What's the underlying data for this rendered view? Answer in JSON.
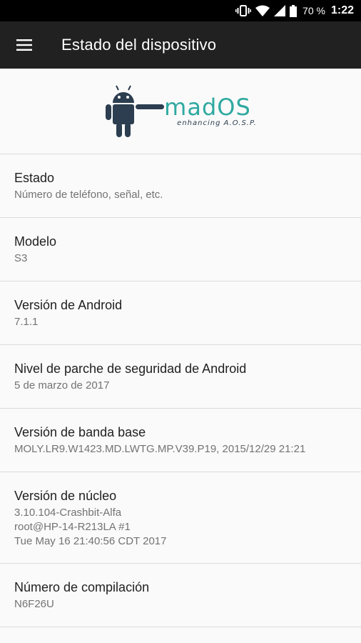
{
  "status_bar": {
    "icons": [
      "vibrate-icon",
      "wifi-icon",
      "cell-signal-icon",
      "battery-icon"
    ],
    "battery_percent": "70 %",
    "time": "1:22"
  },
  "app_bar": {
    "title": "Estado del dispositivo",
    "menu_icon": "hamburger-menu-icon"
  },
  "logo": {
    "word": "madOS",
    "tagline": "enhancing A.O.S.P.",
    "colors": {
      "robot": "#2c3e50",
      "word": "#2fa9a0"
    }
  },
  "items": [
    {
      "title": "Estado",
      "summary": "Número de teléfono, señal, etc."
    },
    {
      "title": "Modelo",
      "summary": "S3"
    },
    {
      "title": "Versión de Android",
      "summary": "7.1.1"
    },
    {
      "title": "Nivel de parche de seguridad de Android",
      "summary": "5 de marzo de 2017"
    },
    {
      "title": "Versión de banda base",
      "summary": "MOLY.LR9.W1423.MD.LWTG.MP.V39.P19, 2015/12/29 21:21"
    },
    {
      "title": "Versión de núcleo",
      "summary_lines": [
        "3.10.104-Crashbit-Alfa",
        "root@HP-14-R213LA #1",
        "Tue May 16 21:40:56 CDT 2017"
      ]
    },
    {
      "title": "Número de compilación",
      "summary": "N6F26U"
    }
  ],
  "colors": {
    "app_bar": "#212121",
    "status_bar": "#000000",
    "background": "#fafafa",
    "divider": "#dcdcdc"
  }
}
